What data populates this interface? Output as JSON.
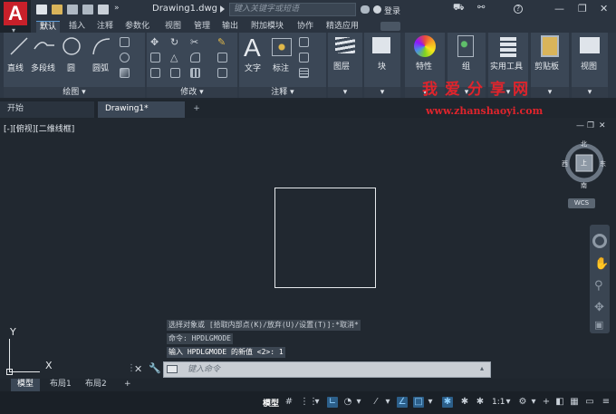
{
  "titlebar": {
    "doc_title": "Drawing1.dwg",
    "search_placeholder": "键入关键字或短语",
    "login": "登录"
  },
  "ribbon_tabs": [
    "默认",
    "插入",
    "注释",
    "参数化",
    "视图",
    "管理",
    "输出",
    "附加模块",
    "协作",
    "精选应用"
  ],
  "ribbon": {
    "draw": {
      "tools": [
        "直线",
        "多段线",
        "圆",
        "圆弧"
      ],
      "panel_label": "绘图 ▾"
    },
    "modify": {
      "panel_label": "修改 ▾"
    },
    "annotation": {
      "tools": [
        "文字",
        "标注"
      ],
      "panel_label": "注释 ▾"
    },
    "big_tools": [
      "图层",
      "块",
      "特性",
      "组",
      "实用工具",
      "剪贴板",
      "视图"
    ]
  },
  "file_tabs": {
    "start": "开始",
    "drawing": "Drawing1*",
    "add": "+"
  },
  "canvas": {
    "view_label": "[-][俯视][二维线框]",
    "viewcube": {
      "north": "北",
      "south": "南",
      "west": "西",
      "east": "东",
      "top": "上"
    },
    "wcs": "WCS",
    "ucs_x": "X",
    "ucs_y": "Y"
  },
  "command": {
    "history": [
      "选择对象或 [拾取内部点(K)/放弃(U)/设置(T)]:*取消*",
      "命令: HPDLGMODE",
      "输入 HPDLGMODE 的新值 <2>: 1"
    ],
    "input_placeholder": "键入命令"
  },
  "layout_tabs": [
    "模型",
    "布局1",
    "布局2"
  ],
  "status": {
    "model": "模型",
    "scale": "1:1"
  },
  "watermark": {
    "cn": "我爱分享网",
    "url": "www.zhanshaoyi.com"
  },
  "colors": {
    "accent": "#5b9bd5",
    "app_red": "#c8202a",
    "watermark": "#e0242c"
  }
}
